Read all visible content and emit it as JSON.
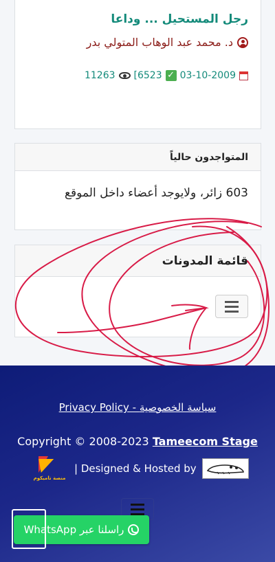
{
  "article": {
    "title": "رجل المستحيل ... وداعا",
    "author": "د. محمد عبد الوهاب المتولي بدر",
    "date": "03-10-2009",
    "rating": "[6523",
    "views": "11263",
    "icons": [
      "calendar-icon",
      "check-icon",
      "eye-icon",
      "user-circle-icon"
    ]
  },
  "online": {
    "header": "المتواجدون حالياً",
    "text": "603 زائر، ولايوجد أعضاء داخل الموقع"
  },
  "blogs": {
    "header": "قائمة المدونات",
    "menu_icon": "hamburger-icon"
  },
  "footer": {
    "privacy": "Privacy Policy - سياسة الخصوصية",
    "copyright_prefix": "Copyright © 2008-2023 ",
    "copyright_brand": "Tameecom Stage",
    "designed": "| Designed & Hosted by",
    "logo_text": "منصة تاميكوم",
    "whatsapp": "راسلنا عبر WhatsApp",
    "colors": {
      "footer_start": "#0e1c78",
      "footer_end": "#3b4aa6",
      "whatsapp": "#25d366",
      "title": "#138a7a",
      "author": "#8b1c18"
    }
  }
}
